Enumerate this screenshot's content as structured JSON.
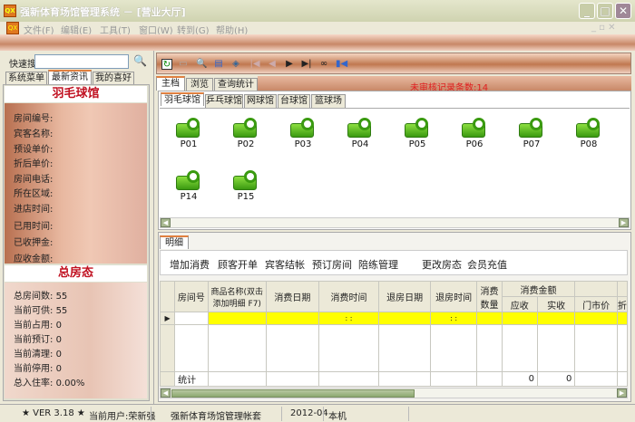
{
  "window": {
    "title": "强新体育场馆管理系统 － [营业大厅]",
    "app_icon_text": "QX"
  },
  "menu": [
    "文件(F)",
    "编辑(E)",
    "工具(T)",
    "窗口(W)",
    "转到(G)",
    "帮助(H)"
  ],
  "left": {
    "search_label": "快速搜索",
    "search_value": "",
    "tabs": [
      "系统菜单",
      "最新资讯",
      "我的喜好"
    ],
    "room_title": "羽毛球馆",
    "room_fields": [
      "房间编号:",
      "宾客名称:",
      "预设单价:",
      "折后单价:",
      "房间电话:",
      "所在区域:",
      "进店时间:",
      "已用时间:",
      "已收押金:",
      "应收金额:"
    ],
    "status_title": "总房态",
    "status_fields": [
      {
        "label": "总房间数:",
        "value": "55"
      },
      {
        "label": "当前可供:",
        "value": "55"
      },
      {
        "label": "当前占用:",
        "value": "0"
      },
      {
        "label": "当前预订:",
        "value": "0"
      },
      {
        "label": "当前清理:",
        "value": "0"
      },
      {
        "label": "当前停用:",
        "value": "0"
      },
      {
        "label": "总入住率:",
        "value": "0.00%"
      }
    ]
  },
  "main": {
    "tabs": [
      "主档",
      "浏览",
      "查询统计"
    ],
    "unreviewed": "未审核记录条数:14",
    "venue_tabs": [
      "羽毛球馆",
      "乒乓球馆",
      "网球馆",
      "台球馆",
      "篮球场"
    ],
    "rooms": [
      "P01",
      "P02",
      "P03",
      "P04",
      "P05",
      "P06",
      "P07",
      "P08",
      "P14",
      "P15"
    ],
    "detail_tab": "明细",
    "actions": [
      "增加消费",
      "顾客开单",
      "宾客结帐",
      "预订房间",
      "陪练管理",
      "更改房态",
      "会员充值"
    ],
    "columns": {
      "room": "房间号",
      "product": "商品名称(双击添加明细 F7)",
      "date": "消费日期",
      "time": "消费时间",
      "out_date": "退房日期",
      "out_time": "退房时间",
      "qty": "消费数量",
      "amount": "消费金额",
      "due": "应收",
      "paid": "实收",
      "retail": "门市价",
      "disc": "折"
    },
    "row_time": ": :",
    "total_label": "统计",
    "total_due": "0",
    "total_paid": "0"
  },
  "status": {
    "version": "★ VER 3.18 ★",
    "user": "当前用户:荣新强",
    "account": "强新体育场馆管理帐套",
    "period": "2012-04",
    "host": "本机"
  }
}
